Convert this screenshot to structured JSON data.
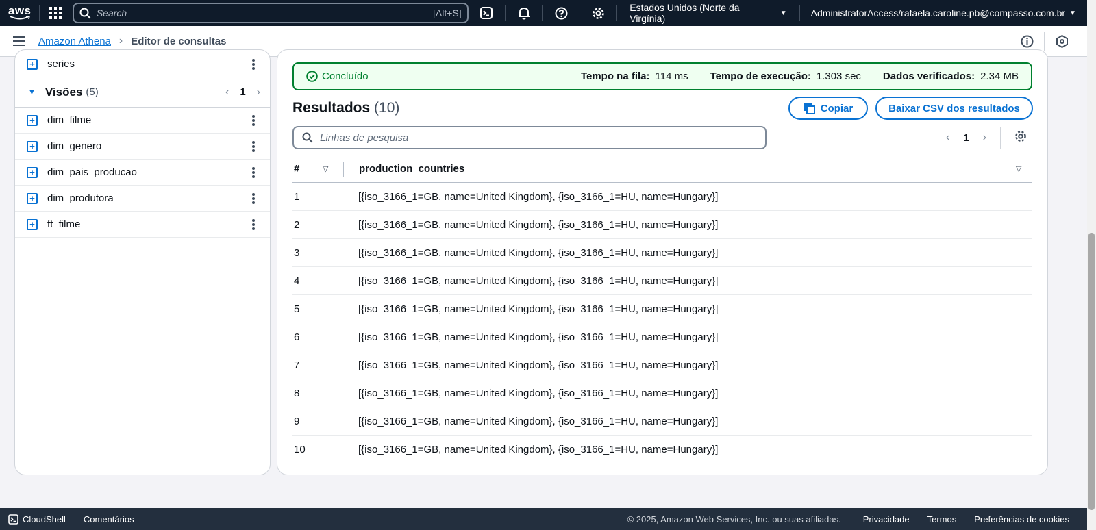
{
  "topnav": {
    "logo_text": "aws",
    "search_placeholder": "Search",
    "search_shortcut": "[Alt+S]",
    "region": "Estados Unidos (Norte da Virgínia)",
    "account": "AdministratorAccess/rafaela.caroline.pb@compasso.com.br"
  },
  "breadcrumb": {
    "service": "Amazon Athena",
    "current": "Editor de consultas"
  },
  "sidebar": {
    "top_item": "series",
    "section": {
      "title": "Visões",
      "count": "(5)",
      "page": "1"
    },
    "items": [
      "dim_filme",
      "dim_genero",
      "dim_pais_producao",
      "dim_produtora",
      "ft_filme"
    ]
  },
  "status": {
    "state": "Concluído",
    "queue_label": "Tempo na fila:",
    "queue_value": "114 ms",
    "exec_label": "Tempo de execução:",
    "exec_value": "1.303 sec",
    "data_label": "Dados verificados:",
    "data_value": "2.34 MB"
  },
  "results": {
    "title": "Resultados",
    "count": "(10)",
    "copy_label": "Copiar",
    "download_label": "Baixar CSV dos resultados",
    "filter_placeholder": "Linhas de pesquisa",
    "page": "1",
    "columns": [
      "#",
      "production_countries"
    ],
    "rows": [
      [
        "1",
        "[{iso_3166_1=GB, name=United Kingdom}, {iso_3166_1=HU, name=Hungary}]"
      ],
      [
        "2",
        "[{iso_3166_1=GB, name=United Kingdom}, {iso_3166_1=HU, name=Hungary}]"
      ],
      [
        "3",
        "[{iso_3166_1=GB, name=United Kingdom}, {iso_3166_1=HU, name=Hungary}]"
      ],
      [
        "4",
        "[{iso_3166_1=GB, name=United Kingdom}, {iso_3166_1=HU, name=Hungary}]"
      ],
      [
        "5",
        "[{iso_3166_1=GB, name=United Kingdom}, {iso_3166_1=HU, name=Hungary}]"
      ],
      [
        "6",
        "[{iso_3166_1=GB, name=United Kingdom}, {iso_3166_1=HU, name=Hungary}]"
      ],
      [
        "7",
        "[{iso_3166_1=GB, name=United Kingdom}, {iso_3166_1=HU, name=Hungary}]"
      ],
      [
        "8",
        "[{iso_3166_1=GB, name=United Kingdom}, {iso_3166_1=HU, name=Hungary}]"
      ],
      [
        "9",
        "[{iso_3166_1=GB, name=United Kingdom}, {iso_3166_1=HU, name=Hungary}]"
      ],
      [
        "10",
        "[{iso_3166_1=GB, name=United Kingdom}, {iso_3166_1=HU, name=Hungary}]"
      ]
    ]
  },
  "footer": {
    "cloudshell": "CloudShell",
    "feedback": "Comentários",
    "copyright": "© 2025, Amazon Web Services, Inc. ou suas afiliadas.",
    "privacy": "Privacidade",
    "terms": "Termos",
    "cookies": "Preferências de cookies"
  },
  "colors": {
    "nav_bg": "#0f1b2a",
    "accent": "#0972d3",
    "success": "#00802f",
    "footer_bg": "#232f3e"
  }
}
